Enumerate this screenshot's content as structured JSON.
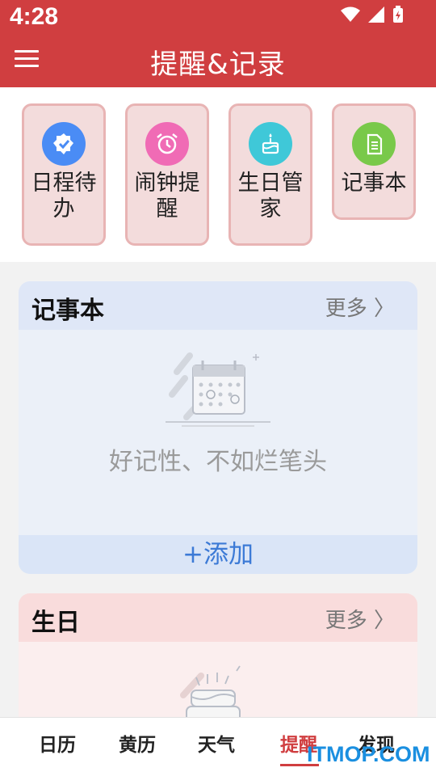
{
  "status": {
    "time": "4:28"
  },
  "appbar": {
    "title": "提醒&记录"
  },
  "quick": [
    {
      "label": "日程待办",
      "icon": "badge-check-icon",
      "color": "#4a8cf5"
    },
    {
      "label": "闹钟提醒",
      "icon": "alarm-clock-icon",
      "color": "#f06bb5"
    },
    {
      "label": "生日管家",
      "icon": "birthday-cake-icon",
      "color": "#3fc8d8"
    },
    {
      "label": "记事本",
      "icon": "document-icon",
      "color": "#79c94a"
    }
  ],
  "notes": {
    "title": "记事本",
    "more": "更多 〉",
    "empty": "好记性、不如烂笔头",
    "add": "+添加"
  },
  "birthday": {
    "title": "生日",
    "more": "更多 〉"
  },
  "tabs": [
    {
      "label": "日历"
    },
    {
      "label": "黄历"
    },
    {
      "label": "天气"
    },
    {
      "label": "提醒"
    },
    {
      "label": "发现"
    }
  ],
  "active_tab": "提醒",
  "watermark": "ITMOP.COM",
  "colors": {
    "accent": "#d03e40",
    "link": "#3c7ad6"
  }
}
